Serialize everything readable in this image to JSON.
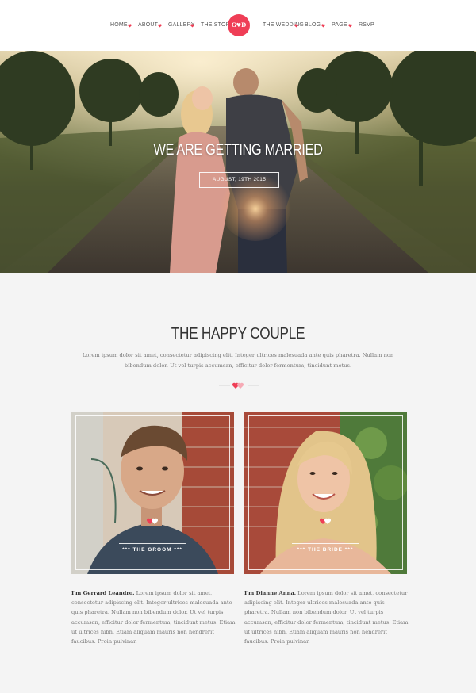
{
  "nav": {
    "left_items": [
      "HOME",
      "ABOUT",
      "GALLERY",
      "THE STORY"
    ],
    "right_items": [
      "THE WEDDING",
      "BLOG",
      "PAGE",
      "RSVP"
    ],
    "logo_text": "G♥D"
  },
  "hero": {
    "title": "WE ARE GETTING MARRIED",
    "date": "AUGUST, 19TH 2015"
  },
  "couple": {
    "title": "THE HAPPY COUPLE",
    "intro": "Lorem ipsum dolor sit amet, consectetur adipiscing elit. Integer ultrices malesuada ante quis pharetra. Nullam non bibendum dolor. Ut vel turpis accumsan, efficitur dolor fermentum, tincidunt metus.",
    "groom": {
      "badge": "*** THE GROOM ***",
      "name": "I'm Gerrard Leandro.",
      "bio": " Lorem ipsum dolor sit amet, consectetur adipiscing elit. Integer ultrices malesuada ante quis pharetra. Nullam non bibendum dolor. Ut vel turpis accumsan, efficitur dolor fermentum, tincidunt metus. Etiam ut ultrices nibh. Etiam aliquam mauris non hendrerit faucibus. Proin pulvinar."
    },
    "bride": {
      "badge": "*** THE BRIDE ***",
      "name": "I'm Dianne Anna.",
      "bio": " Lorem ipsum dolor sit amet, consectetur adipiscing elit. Integer ultrices malesuada ante quis pharetra. Nullam non bibendum dolor. Ut vel turpis accumsan, efficitur dolor fermentum, tincidunt metus. Etiam ut ultrices nibh. Etiam aliquam mauris non hendrerit faucibus. Proin pulvinar."
    }
  },
  "colors": {
    "accent": "#ef3e56",
    "page_bg": "#f4f4f4",
    "nav_bg": "#ffffff"
  },
  "icons": [
    "heart-icon",
    "hearts-icon"
  ]
}
